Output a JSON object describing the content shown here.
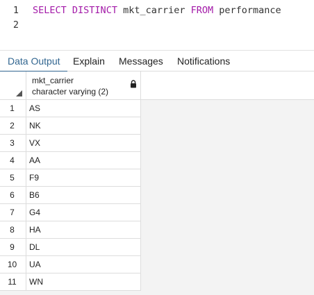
{
  "editor": {
    "lines": [
      {
        "number": "1",
        "tokens": [
          {
            "text": "SELECT",
            "kind": "keyword"
          },
          {
            "text": " ",
            "kind": "plain"
          },
          {
            "text": "DISTINCT",
            "kind": "keyword"
          },
          {
            "text": " mkt_carrier ",
            "kind": "plain"
          },
          {
            "text": "FROM",
            "kind": "keyword"
          },
          {
            "text": " performance",
            "kind": "plain"
          }
        ]
      },
      {
        "number": "2",
        "tokens": []
      }
    ],
    "colors": {
      "keyword": "#a31aa8",
      "plain": "#333333"
    }
  },
  "tabs": [
    {
      "label": "Data Output",
      "active": true
    },
    {
      "label": "Explain",
      "active": false
    },
    {
      "label": "Messages",
      "active": false
    },
    {
      "label": "Notifications",
      "active": false
    }
  ],
  "grid": {
    "column": {
      "name": "mkt_carrier",
      "type": "character varying (2)",
      "icon": "lock-icon"
    },
    "rows": [
      {
        "num": "1",
        "value": "AS"
      },
      {
        "num": "2",
        "value": "NK"
      },
      {
        "num": "3",
        "value": "VX"
      },
      {
        "num": "4",
        "value": "AA"
      },
      {
        "num": "5",
        "value": "F9"
      },
      {
        "num": "6",
        "value": "B6"
      },
      {
        "num": "7",
        "value": "G4"
      },
      {
        "num": "8",
        "value": "HA"
      },
      {
        "num": "9",
        "value": "DL"
      },
      {
        "num": "10",
        "value": "UA"
      },
      {
        "num": "11",
        "value": "WN"
      }
    ]
  },
  "colors": {
    "accent": "#326690",
    "keyword": "#a31aa8"
  }
}
